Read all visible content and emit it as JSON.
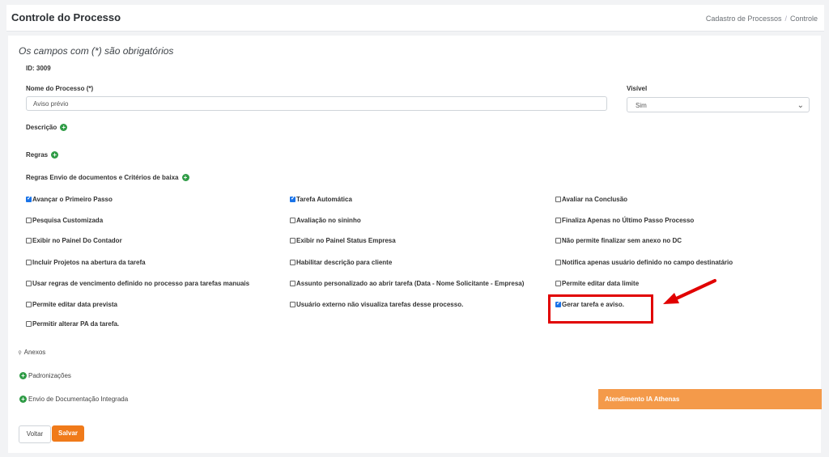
{
  "header": {
    "title": "Controle do Processo",
    "breadcrumb": [
      "Cadastro de Processos",
      "Controle"
    ]
  },
  "form": {
    "required_note": "Os campos com (*) são obrigatórios",
    "id_label": "ID: 3009",
    "name_label": "Nome do Processo (*)",
    "name_value": "Aviso prévio",
    "visible_label": "Visível",
    "visible_value": "Sim",
    "descricao_label": "Descrição",
    "regras_label": "Regras",
    "regras_envio_label": "Regras Envio de documentos e Critérios de baixa"
  },
  "checkboxes": [
    {
      "label": "Avançar o Primeiro Passo",
      "checked": true
    },
    {
      "label": "Tarefa Automática",
      "checked": true
    },
    {
      "label": "Avaliar na Conclusão",
      "checked": false
    },
    {
      "label": "Pesquisa Customizada",
      "checked": false
    },
    {
      "label": "Avaliação no sininho",
      "checked": false
    },
    {
      "label": "Finaliza Apenas no Último Passo Processo",
      "checked": false
    },
    {
      "label": "Exibir no Painel Do Contador",
      "checked": false
    },
    {
      "label": "Exibir no Painel Status Empresa",
      "checked": false
    },
    {
      "label": "Não permite finalizar sem anexo no DC",
      "checked": false
    },
    {
      "label": "Incluir Projetos na abertura da tarefa",
      "checked": false
    },
    {
      "label": "Habilitar descrição para cliente",
      "checked": false
    },
    {
      "label": "Notifica apenas usuário definido no campo destinatário",
      "checked": false
    },
    {
      "label": "Usar regras de vencimento definido no processo para tarefas manuais",
      "checked": false
    },
    {
      "label": "Assunto personalizado ao abrir tarefa (Data - Nome Solicitante - Empresa)",
      "checked": false
    },
    {
      "label": "Permite editar data limite",
      "checked": false
    },
    {
      "label": "Permite editar data prevista",
      "checked": false
    },
    {
      "label": "Usuário externo não visualiza tarefas desse processo.",
      "checked": false
    },
    {
      "label": "Gerar tarefa e aviso.",
      "checked": true
    },
    {
      "label": "Permitir alterar PA da tarefa.",
      "checked": false
    }
  ],
  "sections": {
    "anexos": "Anexos",
    "padronizacoes": "Padronizações",
    "envio": "Envio de Documentação Integrada"
  },
  "chat": {
    "label": "Atendimento IA Athenas"
  },
  "buttons": {
    "voltar": "Voltar",
    "salvar": "Salvar"
  },
  "colors": {
    "accent": "#f07a1a",
    "check": "#1a73e8",
    "plus": "#2e9b45",
    "highlight": "#e10000"
  }
}
